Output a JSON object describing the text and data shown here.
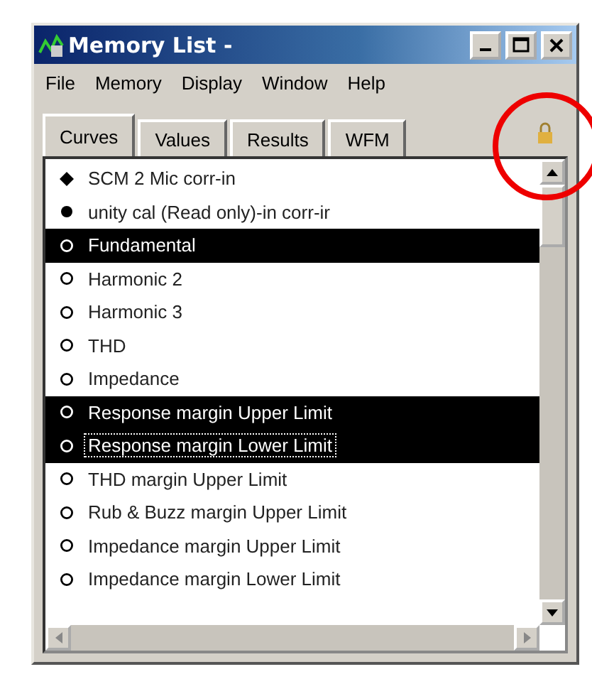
{
  "window": {
    "title": "Memory List -"
  },
  "menu": [
    "File",
    "Memory",
    "Display",
    "Window",
    "Help"
  ],
  "tabs": [
    {
      "label": "Curves",
      "selected": true
    },
    {
      "label": "Values",
      "selected": false
    },
    {
      "label": "Results",
      "selected": false
    },
    {
      "label": "WFM",
      "selected": false
    }
  ],
  "curves": [
    {
      "label": "SCM 2 Mic corr-in",
      "kind": "diamond",
      "selected": false,
      "focused": false
    },
    {
      "label": "unity cal (Read only)-in corr-ir",
      "kind": "dot",
      "selected": false,
      "focused": false
    },
    {
      "label": "Fundamental",
      "kind": "ring",
      "selected": true,
      "focused": false
    },
    {
      "label": "Harmonic 2",
      "kind": "ring",
      "selected": false,
      "focused": false
    },
    {
      "label": "Harmonic 3",
      "kind": "ring",
      "selected": false,
      "focused": false
    },
    {
      "label": "THD",
      "kind": "ring",
      "selected": false,
      "focused": false
    },
    {
      "label": "Impedance",
      "kind": "ring",
      "selected": false,
      "focused": false
    },
    {
      "label": "Response margin Upper Limit",
      "kind": "ring",
      "selected": true,
      "focused": false
    },
    {
      "label": "Response margin Lower Limit",
      "kind": "ring",
      "selected": true,
      "focused": true
    },
    {
      "label": "THD margin Upper Limit",
      "kind": "ring",
      "selected": false,
      "focused": false
    },
    {
      "label": "Rub & Buzz margin Upper Limit",
      "kind": "ring",
      "selected": false,
      "focused": false
    },
    {
      "label": "Impedance margin Upper Limit",
      "kind": "ring",
      "selected": false,
      "focused": false
    },
    {
      "label": "Impedance margin Lower Limit",
      "kind": "ring",
      "selected": false,
      "focused": false
    }
  ]
}
